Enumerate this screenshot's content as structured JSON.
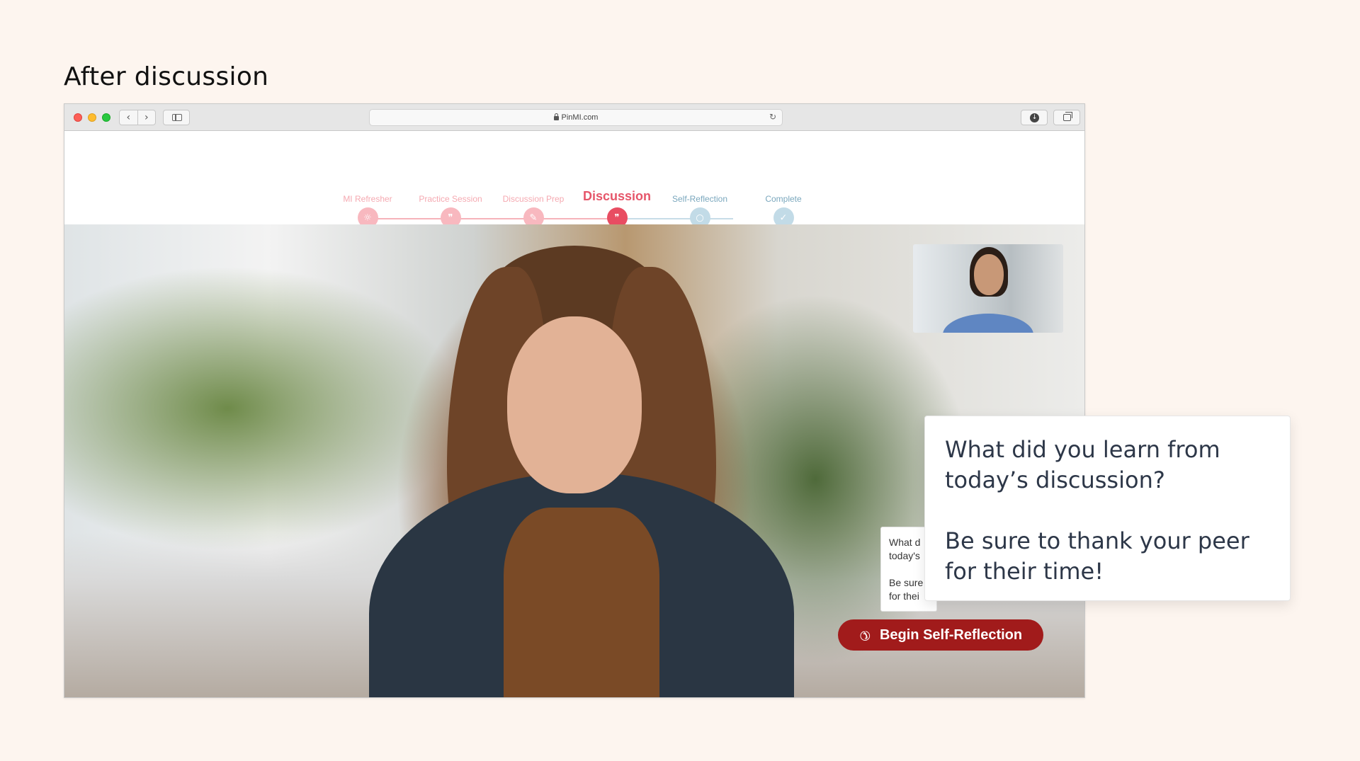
{
  "page": {
    "heading": "After discussion"
  },
  "browser": {
    "url": "PinMI.com",
    "nav_back_icon": "chevron-left-icon",
    "nav_forward_icon": "chevron-right-icon"
  },
  "steps": [
    {
      "label": "MI Refresher",
      "state": "done",
      "icon": "brain-icon"
    },
    {
      "label": "Practice Session",
      "state": "done",
      "icon": "chat-bubbles-icon"
    },
    {
      "label": "Discussion Prep",
      "state": "done",
      "icon": "pencil-icon"
    },
    {
      "label": "Discussion",
      "state": "current",
      "icon": "chat-bubbles-icon"
    },
    {
      "label": "Self-Reflection",
      "state": "todo",
      "icon": "thought-bubble-icon"
    },
    {
      "label": "Complete",
      "state": "todo",
      "icon": "checkmark-icon"
    }
  ],
  "call": {
    "end_button_label": "Begin Self-Reflection",
    "mini_prompt_line1": "What d",
    "mini_prompt_line2": "today's",
    "mini_prompt_line3": "Be sure",
    "mini_prompt_line4": "for thei"
  },
  "callout": {
    "question": "What did you learn from today’s discussion?",
    "reminder": "Be sure to thank your peer for their time!"
  },
  "colors": {
    "background": "#fdf5ef",
    "accent": "#e84d62",
    "end_call": "#a11b1b",
    "upcoming": "#c2dbe7"
  }
}
